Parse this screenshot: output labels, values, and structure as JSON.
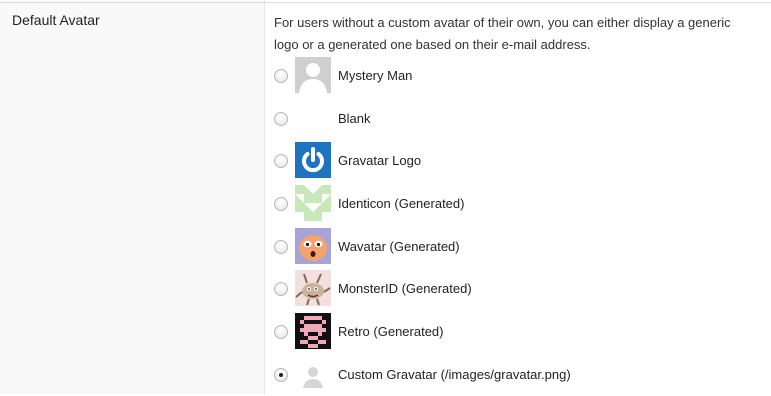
{
  "setting": {
    "label": "Default Avatar",
    "description_line1": "For users without a custom avatar of their own, you can either display a generic",
    "description_line2": "logo or a generated one based on their e-mail address."
  },
  "options": [
    {
      "label": "Mystery Man",
      "icon": "mystery-man-avatar",
      "selected": false
    },
    {
      "label": "Blank",
      "icon": "blank-avatar",
      "selected": false
    },
    {
      "label": "Gravatar Logo",
      "icon": "gravatar-logo-avatar",
      "selected": false
    },
    {
      "label": "Identicon (Generated)",
      "icon": "identicon-avatar",
      "selected": false
    },
    {
      "label": "Wavatar (Generated)",
      "icon": "wavatar-avatar",
      "selected": false
    },
    {
      "label": "MonsterID (Generated)",
      "icon": "monsterid-avatar",
      "selected": false
    },
    {
      "label": "Retro (Generated)",
      "icon": "retro-avatar",
      "selected": false
    },
    {
      "label": "Custom Gravatar (/images/gravatar.png)",
      "icon": "custom-gravatar-avatar",
      "selected": true
    }
  ],
  "colors": {
    "gravatar_blue": "#1e73be",
    "identicon_green": "#c9e8b9",
    "retro_pink": "#f0a8b8"
  }
}
